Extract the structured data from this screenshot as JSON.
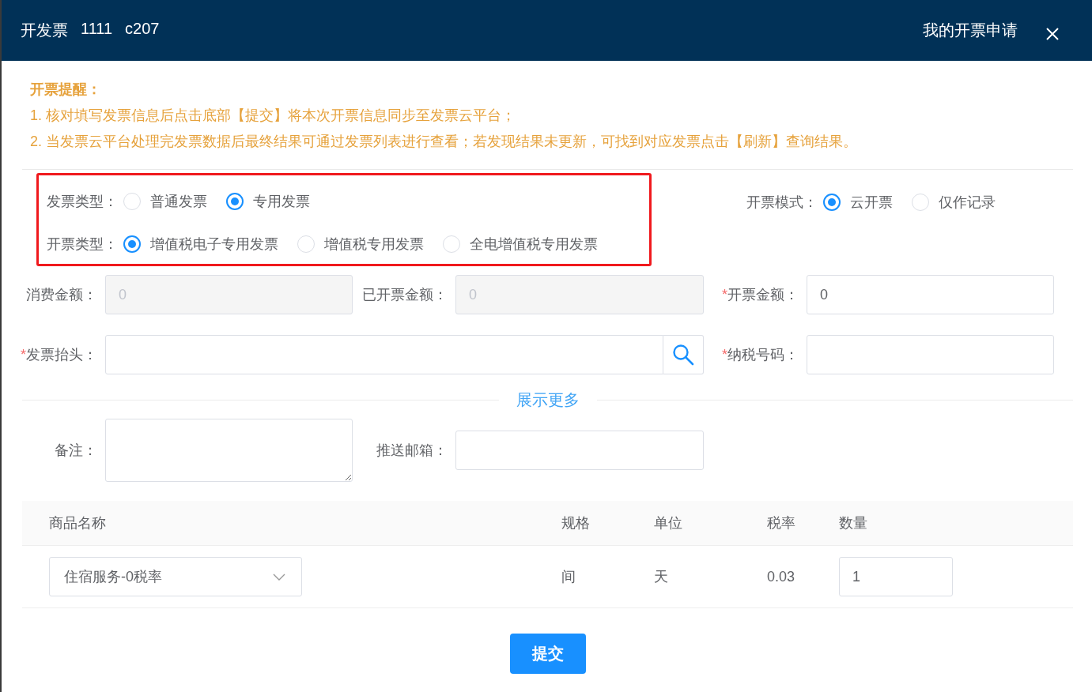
{
  "header": {
    "title_parts": [
      "开发票",
      "1111",
      "c207"
    ],
    "link": "我的开票申请"
  },
  "notice": {
    "title": "开票提醒：",
    "lines": [
      "1. 核对填写发票信息后点击底部【提交】将本次开票信息同步至发票云平台；",
      "2. 当发票云平台处理完发票数据后最终结果可通过发票列表进行查看；若发现结果未更新，可找到对应发票点击【刷新】查询结果。"
    ]
  },
  "invoice_type": {
    "label": "发票类型：",
    "options": [
      {
        "label": "普通发票",
        "selected": false
      },
      {
        "label": "专用发票",
        "selected": true
      }
    ]
  },
  "issue_type": {
    "label": "开票类型：",
    "options": [
      {
        "label": "增值税电子专用发票",
        "selected": true
      },
      {
        "label": "增值税专用发票",
        "selected": false
      },
      {
        "label": "全电增值税专用发票",
        "selected": false
      }
    ]
  },
  "issue_mode": {
    "label": "开票模式：",
    "options": [
      {
        "label": "云开票",
        "selected": true
      },
      {
        "label": "仅作记录",
        "selected": false
      }
    ]
  },
  "amount_fields": [
    {
      "label": "消费金额：",
      "value": "0",
      "disabled": true
    },
    {
      "label": "已开票金额：",
      "value": "0",
      "disabled": true
    },
    {
      "label": "开票金额：",
      "mark": "*",
      "value": "0",
      "disabled": false
    }
  ],
  "title_field": {
    "label": "发票抬头：",
    "mark": "*"
  },
  "tax_field": {
    "label": "纳税号码：",
    "mark": "*"
  },
  "show_more": "展示更多",
  "remark_field": {
    "label": "备注："
  },
  "email_field": {
    "label": "推送邮箱："
  },
  "table": {
    "columns": [
      "商品名称",
      "规格",
      "单位",
      "税率",
      "数量"
    ],
    "rows": [
      {
        "product": "住宿服务-0税率",
        "spec": "间",
        "unit": "天",
        "tax_rate": "0.03",
        "quantity": "1"
      }
    ]
  },
  "submit": "提交"
}
